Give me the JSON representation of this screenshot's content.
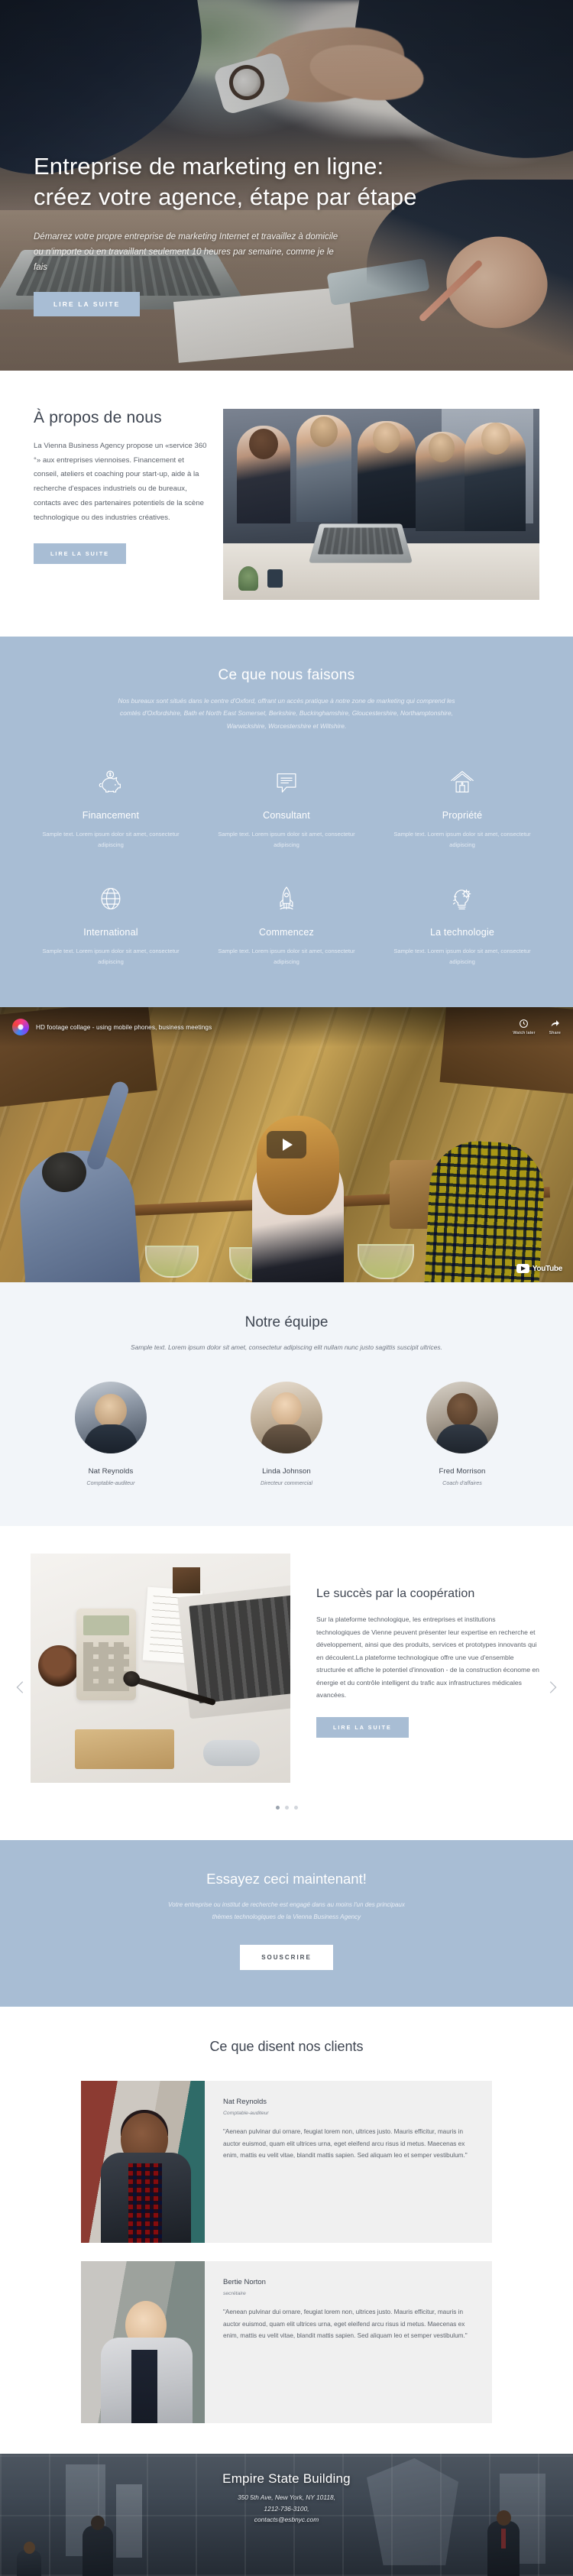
{
  "hero": {
    "title": "Entreprise de marketing en ligne: créez votre agence, étape par étape",
    "subtitle": "Démarrez votre propre entreprise de marketing Internet et travaillez à domicile ou n'importe où en travaillant seulement 10 heures par semaine, comme je le fais",
    "cta_label": "LIRE LA SUITE"
  },
  "about": {
    "title": "À propos de nous",
    "text": "La Vienna Business Agency propose un «service 360 °» aux entreprises viennoises. Financement et conseil, ateliers et coaching pour start-up, aide à la recherche d'espaces industriels ou de bureaux, contacts avec des partenaires potentiels de la scène technologique ou des industries créatives.",
    "cta_label": "LIRE LA SUITE"
  },
  "services": {
    "title": "Ce que nous faisons",
    "subtitle": "Nos bureaux sont situés dans le centre d'Oxford, offrant un accès pratique à notre zone de marketing qui comprend les comtés d'Oxfordshire, Bath et North East Somerset, Berkshire, Buckinghamshire, Gloucestershire, Northamptonshire, Warwickshire, Worcestershire et Wiltshire.",
    "items": [
      {
        "icon": "piggy-bank-icon",
        "name": "Financement",
        "desc": "Sample text. Lorem ipsum dolor sit amet, consectetur adipiscing"
      },
      {
        "icon": "speech-bubble-icon",
        "name": "Consultant",
        "desc": "Sample text. Lorem ipsum dolor sit amet, consectetur adipiscing"
      },
      {
        "icon": "house-icon",
        "name": "Propriété",
        "desc": "Sample text. Lorem ipsum dolor sit amet, consectetur adipiscing"
      },
      {
        "icon": "globe-icon",
        "name": "International",
        "desc": "Sample text. Lorem ipsum dolor sit amet, consectetur adipiscing"
      },
      {
        "icon": "rocket-icon",
        "name": "Commencez",
        "desc": "Sample text. Lorem ipsum dolor sit amet, consectetur adipiscing"
      },
      {
        "icon": "lightbulb-gear-icon",
        "name": "La technologie",
        "desc": "Sample text. Lorem ipsum dolor sit amet, consectetur adipiscing"
      }
    ]
  },
  "video": {
    "title": "HD footage collage - using mobile phones, business meetings",
    "watch_later": "Watch later",
    "share": "Share",
    "brand": "YouTube"
  },
  "team": {
    "title": "Notre équipe",
    "subtitle": "Sample text. Lorem ipsum dolor sit amet, consectetur adipiscing elit nullam nunc justo sagittis suscipit ultrices.",
    "members": [
      {
        "name": "Nat Reynolds",
        "role": "Comptable-auditeur"
      },
      {
        "name": "Linda Johnson",
        "role": "Directeur commercial"
      },
      {
        "name": "Fred Morrison",
        "role": "Coach d'affaires"
      }
    ]
  },
  "success": {
    "title": "Le succès par la coopération",
    "text": "Sur la plateforme technologique, les entreprises et institutions technologiques de Vienne peuvent présenter leur expertise en recherche et développement, ainsi que des produits, services et prototypes innovants qui en découlent.La plateforme technologique offre une vue d'ensemble structurée et affiche le potentiel d'innovation - de la construction économe en énergie et du contrôle intelligent du trafic aux infrastructures médicales avancées.",
    "cta_label": "LIRE LA SUITE"
  },
  "cta": {
    "title": "Essayez ceci maintenant!",
    "subtitle": "Votre entreprise ou institut de recherche est engagé dans au moins l'un des principaux thèmes technologiques de la Vienna Business Agency",
    "button_label": "SOUSCRIRE"
  },
  "testimonials": {
    "title": "Ce que disent nos clients",
    "items": [
      {
        "name": "Nat Reynolds",
        "role": "Comptable-auditeur",
        "quote": "\"Aenean pulvinar dui ornare, feugiat lorem non, ultrices justo. Mauris efficitur, mauris in auctor euismod, quam elit ultrices urna, eget eleifend arcu risus id metus. Maecenas ex enim, mattis eu velit vitae, blandit mattis sapien. Sed aliquam leo et semper vestibulum.\""
      },
      {
        "name": "Bertie Norton",
        "role": "secrétaire",
        "quote": "\"Aenean pulvinar dui ornare, feugiat lorem non, ultrices justo. Mauris efficitur, mauris in auctor euismod, quam elit ultrices urna, eget eleifend arcu risus id metus. Maecenas ex enim, mattis eu velit vitae, blandit mattis sapien. Sed aliquam leo et semper vestibulum.\""
      }
    ]
  },
  "footer": {
    "title": "Empire State Building",
    "address": "350 5th Ave, New York, NY 10118,",
    "phone": "1212-736-3100,",
    "email": "contacts@esbnyc.com"
  },
  "colors": {
    "accent": "#a8bdd4",
    "heading": "#3d4450",
    "body": "#5d636c",
    "light_bg": "#f2f5f9"
  }
}
